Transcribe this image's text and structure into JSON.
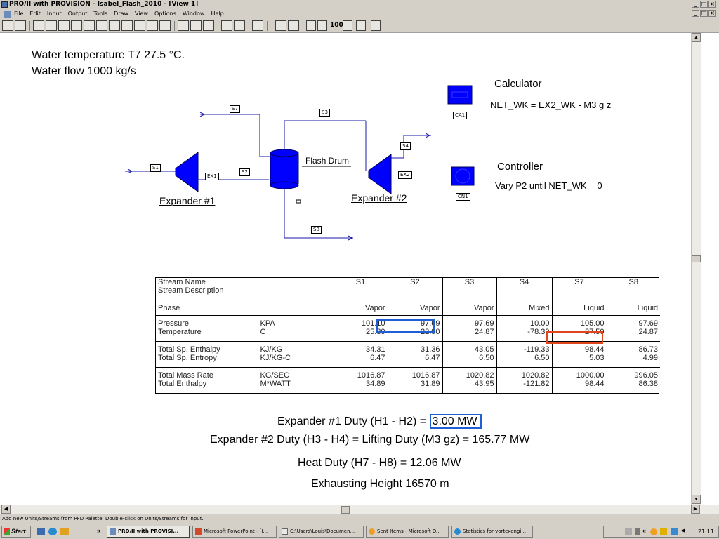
{
  "window": {
    "title": "PRO/II with PROVISION - Isabel_Flash_2010 - [View 1]",
    "controls": [
      "_",
      "□",
      "×"
    ]
  },
  "menu": [
    "File",
    "Edit",
    "Input",
    "Output",
    "Tools",
    "Draw",
    "View",
    "Options",
    "Window",
    "Help"
  ],
  "toolbar": {
    "zoom_label": "100"
  },
  "notes": {
    "line1": "Water temperature T7 27.5 °C.",
    "line2": "Water flow 1000 kg/s"
  },
  "pfd": {
    "streams": {
      "s1": "S1",
      "s2": "S2",
      "s3": "S3",
      "s4": "S4",
      "s7": "S7",
      "s8": "S8"
    },
    "units": {
      "ex1": "EX1",
      "ex2": "EX2",
      "ca1": "CA1",
      "cn1": "CN1"
    },
    "labels": {
      "flash_drum": "Flash Drum",
      "expander1": "Expander #1",
      "expander2": "Expander #2",
      "calculator": "Calculator",
      "calculator_eq": "NET_WK = EX2_WK - M3 g z",
      "controller": "Controller",
      "controller_eq": "Vary P2 until NET_WK = 0"
    }
  },
  "stream_table": {
    "header": {
      "name": "Stream Name",
      "desc": "Stream Description",
      "cols": [
        "S1",
        "S2",
        "S3",
        "S4",
        "S7",
        "S8"
      ]
    },
    "phase": {
      "label": "Phase",
      "values": [
        "Vapor",
        "Vapor",
        "Vapor",
        "Mixed",
        "Liquid",
        "Liquid"
      ]
    },
    "rows": [
      {
        "label1": "Pressure",
        "unit1": "KPA",
        "v1": [
          "101.10",
          "97.69",
          "97.69",
          "10.00",
          "105.00",
          "97.69"
        ],
        "label2": "Temperature",
        "unit2": "C",
        "v2": [
          "25.80",
          "22.90",
          "24.87",
          "-78.39",
          "27.50",
          "24.87"
        ]
      },
      {
        "label1": "Total Sp. Enthalpy",
        "unit1": "KJ/KG",
        "v1": [
          "34.31",
          "31.36",
          "43.05",
          "-119.33",
          "98.44",
          "86.73"
        ],
        "label2": "Total Sp. Entropy",
        "unit2": "KJ/KG-C",
        "v2": [
          "6.47",
          "6.47",
          "6.50",
          "6.50",
          "5.03",
          "4.99"
        ]
      },
      {
        "label1": "Total Mass Rate",
        "unit1": "KG/SEC",
        "v1": [
          "1016.87",
          "1016.87",
          "1020.82",
          "1020.82",
          "1000.00",
          "996.05"
        ],
        "label2": "Total Enthalpy",
        "unit2": "M*WATT",
        "v2": [
          "34.89",
          "31.89",
          "43.95",
          "-121.82",
          "98.44",
          "86.38"
        ]
      }
    ]
  },
  "results": {
    "exp1_prefix": "Expander #1 Duty  (H1 - H2) =",
    "exp1_value": "3.00 MW",
    "exp2": "Expander #2 Duty  (H3 - H4) = Lifting Duty (M3 gz) =  165.77 MW",
    "heat": "Heat Duty (H7 - H8) = 12.06 MW",
    "height": "Exhausting Height 16570 m"
  },
  "status": {
    "text": "Add new Units/Streams from PFD Palette.  Double-click on Units/Streams for input."
  },
  "taskbar": {
    "start": "Start",
    "tasks": [
      "PRO/II with PROVISI...",
      "Microsoft PowerPoint - [I...",
      "C:\\Users\\Louis\\Documen...",
      "Sent Items - Microsoft O...",
      "Statistics for vortexengi..."
    ],
    "clock": "21:11"
  },
  "colors": {
    "unit_blue": "#0000ff",
    "stream_line": "#1a1aa8",
    "highlight_blue": "#1f5fd6",
    "highlight_red": "#e0451c"
  }
}
